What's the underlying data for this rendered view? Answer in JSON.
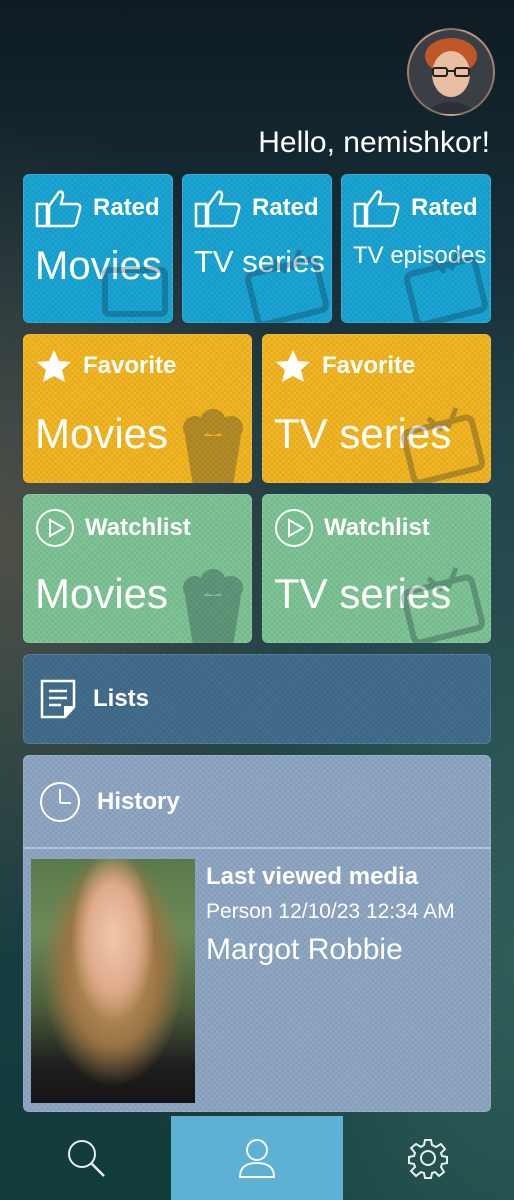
{
  "header": {
    "greeting": "Hello, nemishkor!"
  },
  "rated": [
    {
      "label": "Rated",
      "title": "Movies"
    },
    {
      "label": "Rated",
      "title": "TV series"
    },
    {
      "label": "Rated",
      "title": "TV episodes"
    }
  ],
  "favorite": [
    {
      "label": "Favorite",
      "title": "Movies"
    },
    {
      "label": "Favorite",
      "title": "TV series"
    }
  ],
  "watchlist": [
    {
      "label": "Watchlist",
      "title": "Movies"
    },
    {
      "label": "Watchlist",
      "title": "TV series"
    }
  ],
  "lists": {
    "label": "Lists"
  },
  "history": {
    "label": "History",
    "last_viewed_title": "Last viewed media",
    "meta": "Person 12/10/23 12:34 AM",
    "name": "Margot Robbie"
  },
  "icons": {
    "rated": "thumbs-up-icon",
    "favorite": "star-icon",
    "watchlist": "play-circle-icon",
    "lists": "document-icon",
    "history": "clock-icon",
    "nav": [
      "search-icon",
      "user-icon",
      "gear-icon"
    ]
  },
  "colors": {
    "rated": "#1aa5d4",
    "favorite": "#f3b623",
    "watchlist": "#7ec496",
    "lists": "#426d8c",
    "history": "#8fa7c4",
    "nav_active": "#5fb1d3"
  }
}
